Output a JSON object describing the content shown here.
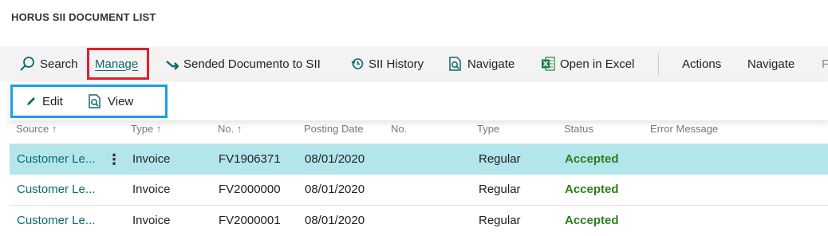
{
  "page": {
    "title": "HORUS SII DOCUMENT LIST"
  },
  "toolbar": {
    "search": "Search",
    "manage": "Manage",
    "sended": "Sended Documento to SII",
    "sii_history": "SII History",
    "navigate": "Navigate",
    "open_excel": "Open in Excel",
    "actions": "Actions",
    "navigate2": "Navigate",
    "overflow": "F"
  },
  "submenu": {
    "edit": "Edit",
    "view": "View"
  },
  "columns": [
    "Source",
    "Type",
    "No.",
    "Posting Date",
    "No.",
    "Type",
    "Status",
    "Error Message"
  ],
  "sort_arrow": "↑",
  "rows": [
    {
      "source": "Customer Le...",
      "type": "Invoice",
      "no": "FV1906371",
      "posting_date": "08/01/2020",
      "no2": "",
      "type2": "Regular",
      "status": "Accepted",
      "error": "",
      "selected": true
    },
    {
      "source": "Customer Le...",
      "type": "Invoice",
      "no": "FV2000000",
      "posting_date": "08/01/2020",
      "no2": "",
      "type2": "Regular",
      "status": "Accepted",
      "error": "",
      "selected": false
    },
    {
      "source": "Customer Le...",
      "type": "Invoice",
      "no": "FV2000001",
      "posting_date": "08/01/2020",
      "no2": "",
      "type2": "Regular",
      "status": "Accepted",
      "error": "",
      "selected": false
    }
  ],
  "row_actions_glyph": "⋮",
  "colors": {
    "accent": "#0b6a6a",
    "selected_row": "#b3e6eb",
    "accepted": "#2e7d1d",
    "highlight_red": "#e0202b",
    "highlight_blue": "#1b9ee6"
  },
  "icons": [
    "search-icon",
    "forward-arrow-icon",
    "history-icon",
    "navigate-icon",
    "excel-icon",
    "pencil-icon",
    "view-icon"
  ]
}
